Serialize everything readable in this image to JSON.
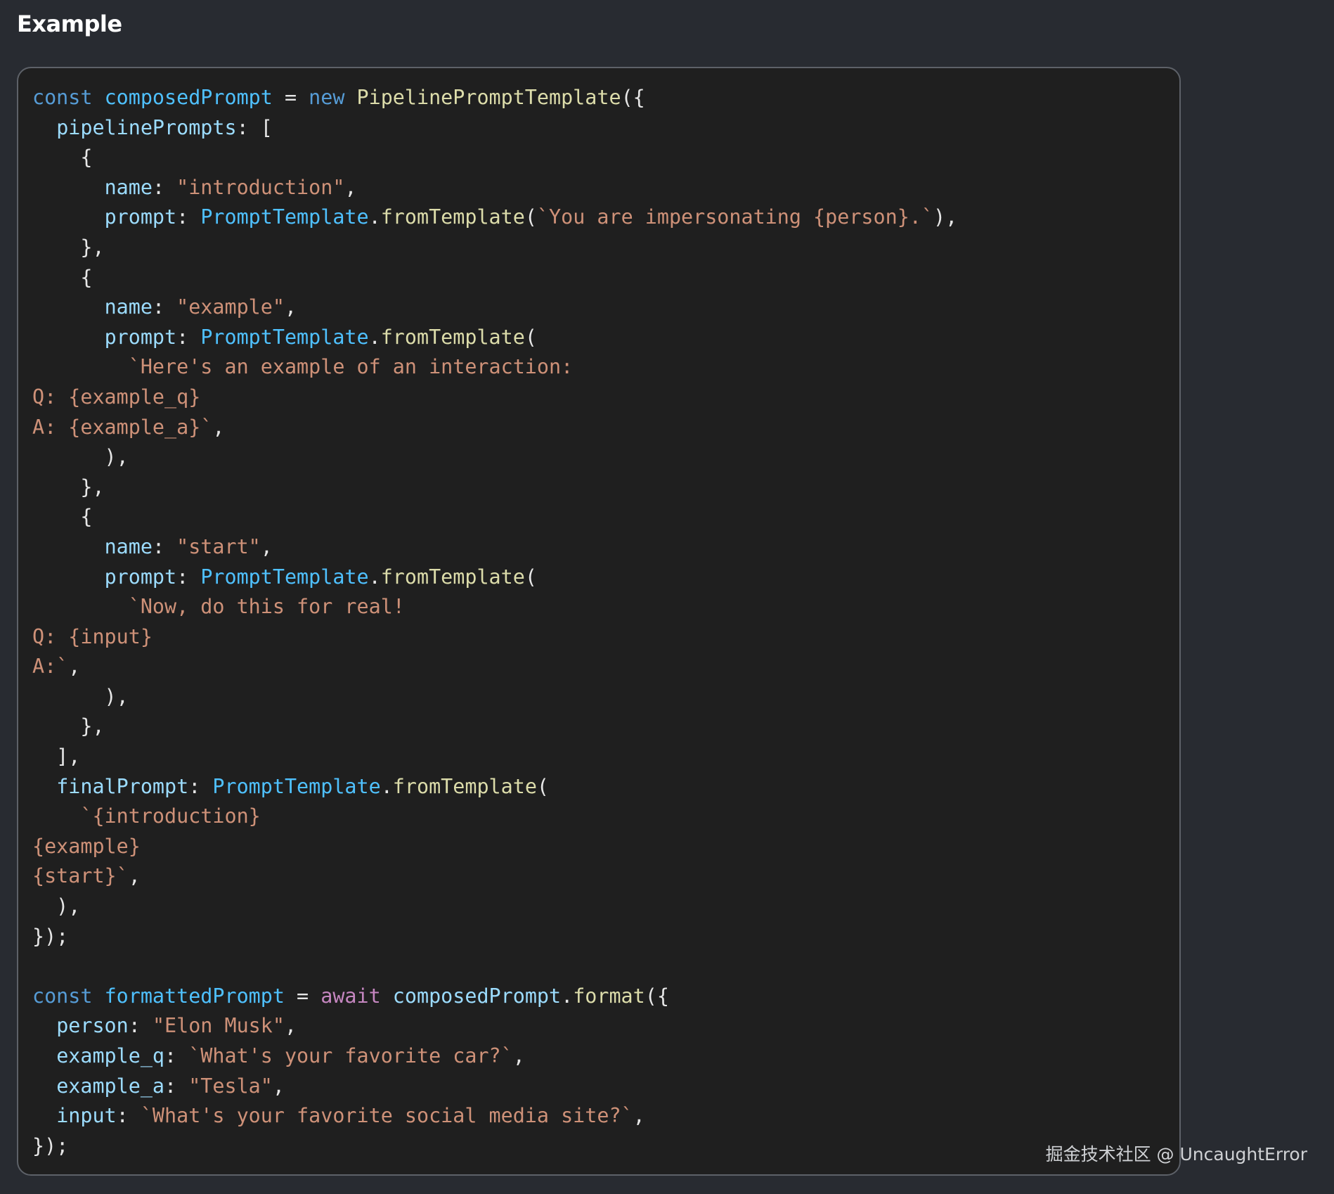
{
  "heading": "Example",
  "code": {
    "lines": [
      [
        {
          "t": "const",
          "c": "kw"
        },
        {
          "t": " ",
          "c": "punc"
        },
        {
          "t": "composedPrompt",
          "c": "var"
        },
        {
          "t": " = ",
          "c": "punc"
        },
        {
          "t": "new",
          "c": "kw"
        },
        {
          "t": " ",
          "c": "punc"
        },
        {
          "t": "PipelinePromptTemplate",
          "c": "cls"
        },
        {
          "t": "({",
          "c": "punc"
        }
      ],
      [
        {
          "t": "  ",
          "c": "punc"
        },
        {
          "t": "pipelinePrompts",
          "c": "prop"
        },
        {
          "t": ": [",
          "c": "punc"
        }
      ],
      [
        {
          "t": "    {",
          "c": "punc"
        }
      ],
      [
        {
          "t": "      ",
          "c": "punc"
        },
        {
          "t": "name",
          "c": "prop"
        },
        {
          "t": ": ",
          "c": "punc"
        },
        {
          "t": "\"introduction\"",
          "c": "str"
        },
        {
          "t": ",",
          "c": "punc"
        }
      ],
      [
        {
          "t": "      ",
          "c": "punc"
        },
        {
          "t": "prompt",
          "c": "prop"
        },
        {
          "t": ": ",
          "c": "punc"
        },
        {
          "t": "PromptTemplate",
          "c": "var"
        },
        {
          "t": ".",
          "c": "punc"
        },
        {
          "t": "fromTemplate",
          "c": "fn"
        },
        {
          "t": "(",
          "c": "punc"
        },
        {
          "t": "`You are impersonating {person}.`",
          "c": "str"
        },
        {
          "t": "),",
          "c": "punc"
        }
      ],
      [
        {
          "t": "    },",
          "c": "punc"
        }
      ],
      [
        {
          "t": "    {",
          "c": "punc"
        }
      ],
      [
        {
          "t": "      ",
          "c": "punc"
        },
        {
          "t": "name",
          "c": "prop"
        },
        {
          "t": ": ",
          "c": "punc"
        },
        {
          "t": "\"example\"",
          "c": "str"
        },
        {
          "t": ",",
          "c": "punc"
        }
      ],
      [
        {
          "t": "      ",
          "c": "punc"
        },
        {
          "t": "prompt",
          "c": "prop"
        },
        {
          "t": ": ",
          "c": "punc"
        },
        {
          "t": "PromptTemplate",
          "c": "var"
        },
        {
          "t": ".",
          "c": "punc"
        },
        {
          "t": "fromTemplate",
          "c": "fn"
        },
        {
          "t": "(",
          "c": "punc"
        }
      ],
      [
        {
          "t": "        ",
          "c": "punc"
        },
        {
          "t": "`Here's an example of an interaction:",
          "c": "str"
        }
      ],
      [
        {
          "t": "Q: {example_q}",
          "c": "str"
        }
      ],
      [
        {
          "t": "A: {example_a}`",
          "c": "str"
        },
        {
          "t": ",",
          "c": "punc"
        }
      ],
      [
        {
          "t": "      ),",
          "c": "punc"
        }
      ],
      [
        {
          "t": "    },",
          "c": "punc"
        }
      ],
      [
        {
          "t": "    {",
          "c": "punc"
        }
      ],
      [
        {
          "t": "      ",
          "c": "punc"
        },
        {
          "t": "name",
          "c": "prop"
        },
        {
          "t": ": ",
          "c": "punc"
        },
        {
          "t": "\"start\"",
          "c": "str"
        },
        {
          "t": ",",
          "c": "punc"
        }
      ],
      [
        {
          "t": "      ",
          "c": "punc"
        },
        {
          "t": "prompt",
          "c": "prop"
        },
        {
          "t": ": ",
          "c": "punc"
        },
        {
          "t": "PromptTemplate",
          "c": "var"
        },
        {
          "t": ".",
          "c": "punc"
        },
        {
          "t": "fromTemplate",
          "c": "fn"
        },
        {
          "t": "(",
          "c": "punc"
        }
      ],
      [
        {
          "t": "        ",
          "c": "punc"
        },
        {
          "t": "`Now, do this for real!",
          "c": "str"
        }
      ],
      [
        {
          "t": "Q: {input}",
          "c": "str"
        }
      ],
      [
        {
          "t": "A:`",
          "c": "str"
        },
        {
          "t": ",",
          "c": "punc"
        }
      ],
      [
        {
          "t": "      ),",
          "c": "punc"
        }
      ],
      [
        {
          "t": "    },",
          "c": "punc"
        }
      ],
      [
        {
          "t": "  ],",
          "c": "punc"
        }
      ],
      [
        {
          "t": "  ",
          "c": "punc"
        },
        {
          "t": "finalPrompt",
          "c": "prop"
        },
        {
          "t": ": ",
          "c": "punc"
        },
        {
          "t": "PromptTemplate",
          "c": "var"
        },
        {
          "t": ".",
          "c": "punc"
        },
        {
          "t": "fromTemplate",
          "c": "fn"
        },
        {
          "t": "(",
          "c": "punc"
        }
      ],
      [
        {
          "t": "    ",
          "c": "punc"
        },
        {
          "t": "`{introduction}",
          "c": "str"
        }
      ],
      [
        {
          "t": "{example}",
          "c": "str"
        }
      ],
      [
        {
          "t": "{start}`",
          "c": "str"
        },
        {
          "t": ",",
          "c": "punc"
        }
      ],
      [
        {
          "t": "  ),",
          "c": "punc"
        }
      ],
      [
        {
          "t": "});",
          "c": "punc"
        }
      ],
      [
        {
          "t": "",
          "c": "punc"
        }
      ],
      [
        {
          "t": "const",
          "c": "kw"
        },
        {
          "t": " ",
          "c": "punc"
        },
        {
          "t": "formattedPrompt",
          "c": "var"
        },
        {
          "t": " = ",
          "c": "punc"
        },
        {
          "t": "await",
          "c": "kw2"
        },
        {
          "t": " ",
          "c": "punc"
        },
        {
          "t": "composedPrompt",
          "c": "obj"
        },
        {
          "t": ".",
          "c": "punc"
        },
        {
          "t": "format",
          "c": "fn"
        },
        {
          "t": "({",
          "c": "punc"
        }
      ],
      [
        {
          "t": "  ",
          "c": "punc"
        },
        {
          "t": "person",
          "c": "prop"
        },
        {
          "t": ": ",
          "c": "punc"
        },
        {
          "t": "\"Elon Musk\"",
          "c": "str"
        },
        {
          "t": ",",
          "c": "punc"
        }
      ],
      [
        {
          "t": "  ",
          "c": "punc"
        },
        {
          "t": "example_q",
          "c": "prop"
        },
        {
          "t": ": ",
          "c": "punc"
        },
        {
          "t": "`What's your favorite car?`",
          "c": "str"
        },
        {
          "t": ",",
          "c": "punc"
        }
      ],
      [
        {
          "t": "  ",
          "c": "punc"
        },
        {
          "t": "example_a",
          "c": "prop"
        },
        {
          "t": ": ",
          "c": "punc"
        },
        {
          "t": "\"Tesla\"",
          "c": "str"
        },
        {
          "t": ",",
          "c": "punc"
        }
      ],
      [
        {
          "t": "  ",
          "c": "punc"
        },
        {
          "t": "input",
          "c": "prop"
        },
        {
          "t": ": ",
          "c": "punc"
        },
        {
          "t": "`What's your favorite social media site?`",
          "c": "str"
        },
        {
          "t": ",",
          "c": "punc"
        }
      ],
      [
        {
          "t": "});",
          "c": "punc"
        }
      ]
    ]
  },
  "watermark": "掘金技术社区 @ UncaughtError",
  "colors": {
    "page_background": "#282b31",
    "code_background": "#1f1f1f",
    "code_border": "#5d6168",
    "keyword": "#569cd6",
    "control_keyword": "#c586c0",
    "variable": "#4fc1ff",
    "class_name": "#dcdcaa",
    "property": "#9cdcfe",
    "string": "#ce9178",
    "function": "#dcdcaa",
    "punctuation": "#e6e6e6"
  }
}
